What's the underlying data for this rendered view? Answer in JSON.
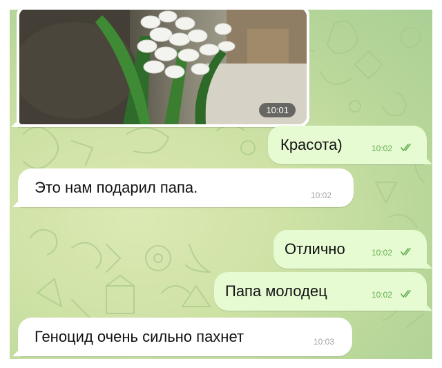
{
  "colors": {
    "incoming_bubble": "#ffffff",
    "outgoing_bubble": "#e6fbd2",
    "read_check": "#62ad4f",
    "chat_background": "#cfe2a6"
  },
  "photo_message": {
    "time": "10:01",
    "content": "photo of white hyacinth flowers"
  },
  "messages": [
    {
      "direction": "outgoing",
      "text": "Красота)",
      "time": "10:02",
      "status_icon": "double-check-icon"
    },
    {
      "direction": "incoming",
      "text": "Это нам подарил папа.",
      "time": "10:02"
    },
    {
      "direction": "outgoing",
      "text": "Отлично",
      "time": "10:02",
      "status_icon": "double-check-icon"
    },
    {
      "direction": "outgoing",
      "text": "Папа молодец",
      "time": "10:02",
      "status_icon": "double-check-icon"
    },
    {
      "direction": "incoming",
      "text": "Геноцид очень сильно пахнет",
      "time": "10:03"
    }
  ]
}
